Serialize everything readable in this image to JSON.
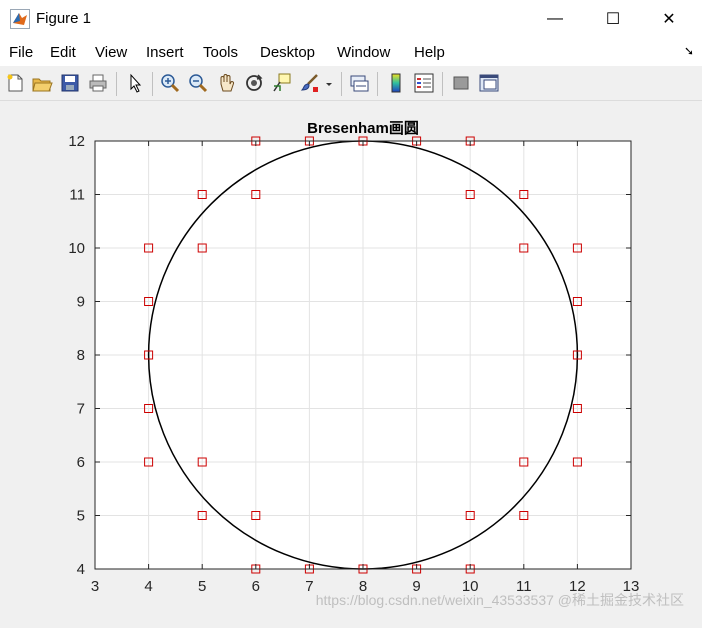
{
  "window": {
    "title": "Figure 1",
    "minimize_glyph": "—",
    "maximize_glyph": "☐",
    "close_glyph": "✕"
  },
  "menu": {
    "items": [
      "File",
      "Edit",
      "View",
      "Insert",
      "Tools",
      "Desktop",
      "Window",
      "Help"
    ],
    "dock_glyph": "➘"
  },
  "toolbar": {
    "icons": [
      "new-figure-icon",
      "open-file-icon",
      "save-icon",
      "print-icon",
      "pointer-icon",
      "zoom-in-icon",
      "zoom-out-icon",
      "pan-hand-icon",
      "rotate-3d-icon",
      "data-cursor-icon",
      "brush-icon",
      "link-plot-icon",
      "colorbar-icon",
      "legend-icon",
      "hide-plot-tools-icon",
      "show-plot-tools-icon"
    ]
  },
  "chart_data": {
    "type": "scatter",
    "title": "Bresenham画圆",
    "xlabel": "",
    "ylabel": "",
    "xlim": [
      3,
      13
    ],
    "ylim": [
      4,
      12
    ],
    "xticks": [
      3,
      4,
      5,
      6,
      7,
      8,
      9,
      10,
      11,
      12,
      13
    ],
    "yticks": [
      4,
      5,
      6,
      7,
      8,
      9,
      10,
      11,
      12
    ],
    "grid": true,
    "circle": {
      "cx": 8,
      "cy": 8,
      "r": 4,
      "color": "#000000"
    },
    "marker": {
      "shape": "square",
      "color": "#cc0000"
    },
    "points": [
      [
        6,
        12
      ],
      [
        7,
        12
      ],
      [
        8,
        12
      ],
      [
        9,
        12
      ],
      [
        10,
        12
      ],
      [
        5,
        11
      ],
      [
        6,
        11
      ],
      [
        10,
        11
      ],
      [
        11,
        11
      ],
      [
        4,
        10
      ],
      [
        5,
        10
      ],
      [
        11,
        10
      ],
      [
        12,
        10
      ],
      [
        4,
        9
      ],
      [
        12,
        9
      ],
      [
        4,
        8
      ],
      [
        12,
        8
      ],
      [
        4,
        7
      ],
      [
        12,
        7
      ],
      [
        4,
        6
      ],
      [
        5,
        6
      ],
      [
        11,
        6
      ],
      [
        12,
        6
      ],
      [
        5,
        5
      ],
      [
        6,
        5
      ],
      [
        10,
        5
      ],
      [
        11,
        5
      ],
      [
        6,
        4
      ],
      [
        7,
        4
      ],
      [
        8,
        4
      ],
      [
        9,
        4
      ],
      [
        10,
        4
      ]
    ]
  },
  "watermark": "https://blog.csdn.net/weixin_43533537 @稀土掘金技术社区"
}
